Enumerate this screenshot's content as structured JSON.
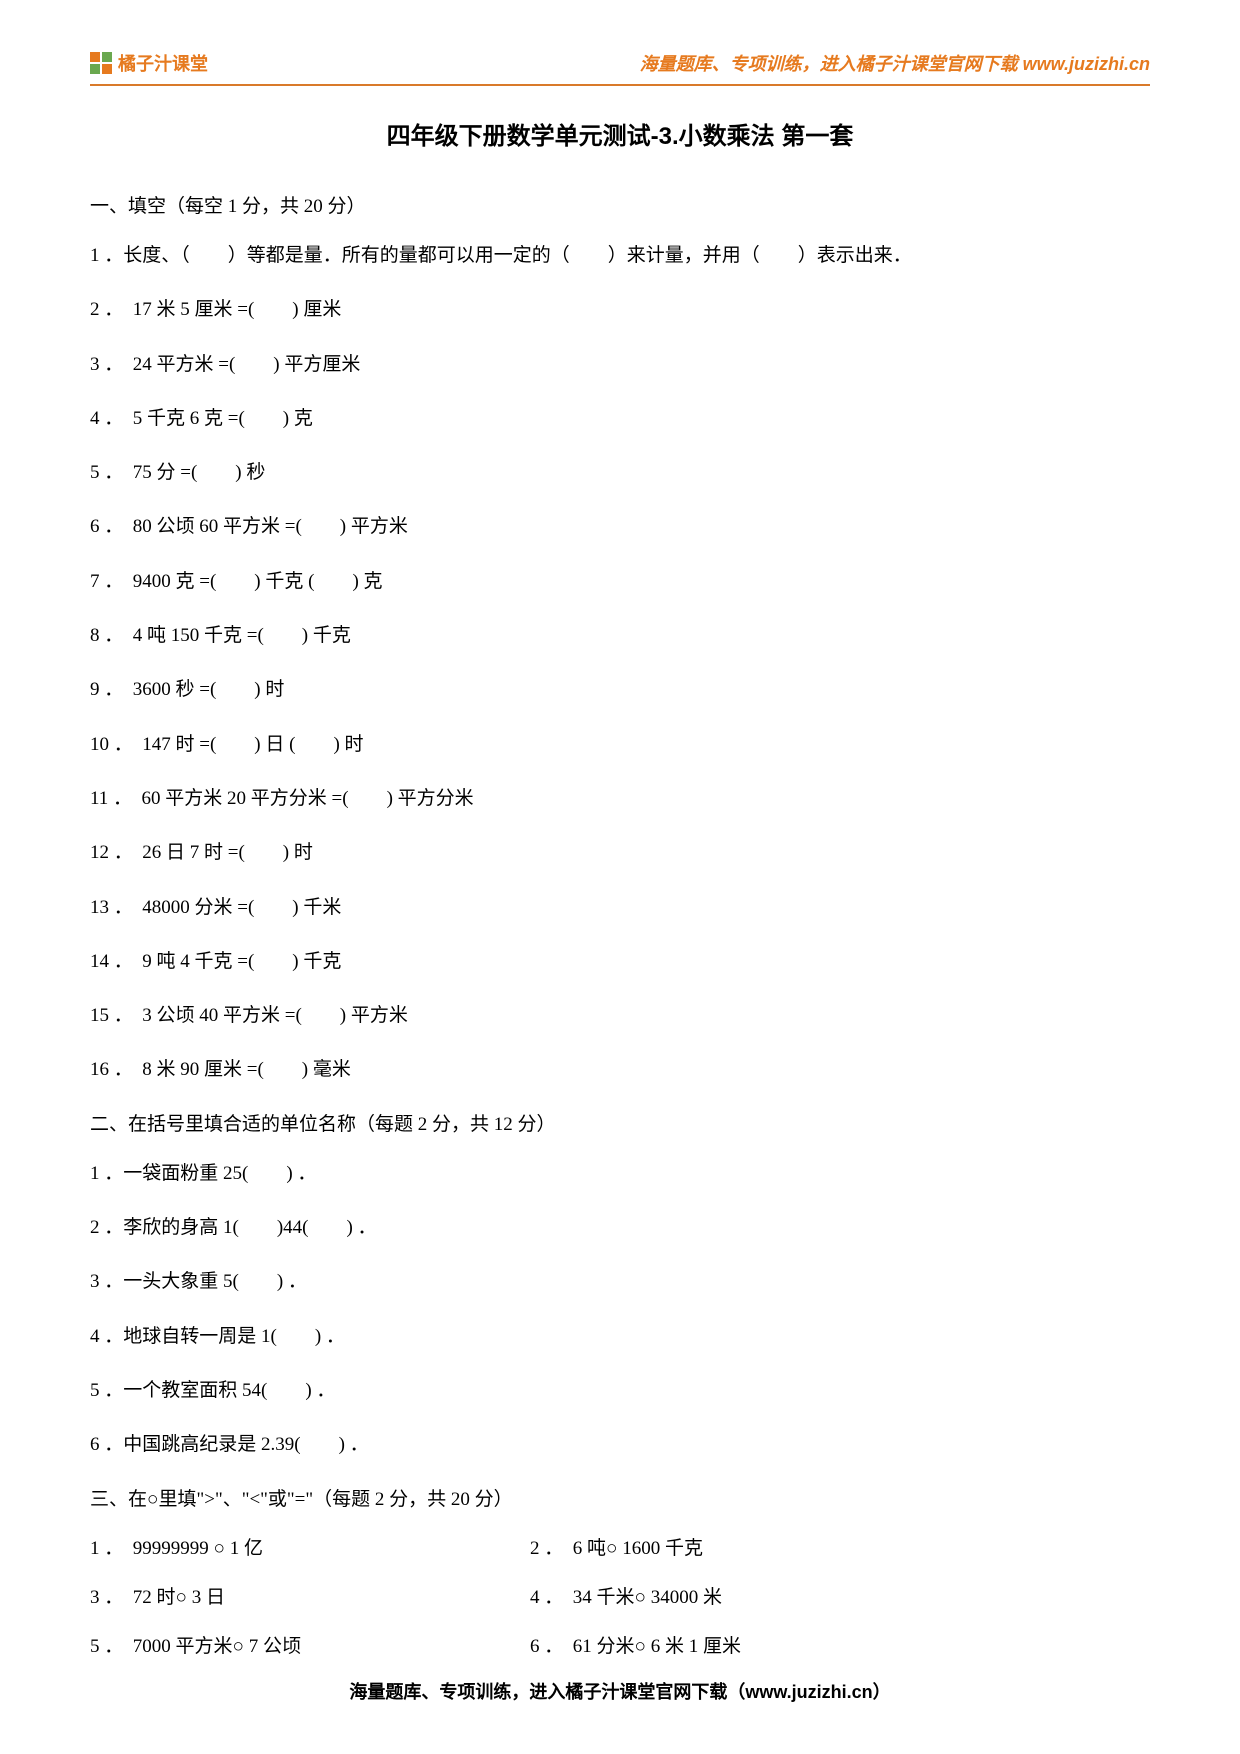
{
  "header": {
    "logo_text": "橘子汁课堂",
    "right_text": "海量题库、专项训练，进入橘子汁课堂官网下载 www.juzizhi.cn"
  },
  "title": "四年级下册数学单元测试-3.小数乘法 第一套",
  "section1": {
    "heading": "一、填空（每空 1 分，共 20 分）",
    "q1": "1 ．长度、（　　）等都是量．所有的量都可以用一定的（　　）来计量，并用（　　）表示出来．",
    "q2": "2 ．　17 米 5 厘米 =(　　) 厘米",
    "q3": "3 ．　24 平方米 =(　　) 平方厘米",
    "q4": "4 ．　5 千克 6 克 =(　　) 克",
    "q5": "5 ．　75 分 =(　　) 秒",
    "q6": "6 ．　80 公顷 60 平方米 =(　　) 平方米",
    "q7": "7 ．　9400 克 =(　　) 千克 (　　) 克",
    "q8": "8 ．　4 吨 150 千克 =(　　) 千克",
    "q9": "9 ．　3600 秒 =(　　) 时",
    "q10": "10 ．　147 时 =(　　) 日 (　　) 时",
    "q11": "11 ．　60 平方米 20 平方分米 =(　　) 平方分米",
    "q12": "12 ．　26 日 7 时 =(　　) 时",
    "q13": "13 ．　48000 分米 =(　　) 千米",
    "q14": "14 ．　9 吨 4 千克 =(　　) 千克",
    "q15": "15 ．　3 公顷 40 平方米 =(　　) 平方米",
    "q16": "16 ．　8 米 90 厘米 =(　　) 毫米"
  },
  "section2": {
    "heading": "二、在括号里填合适的单位名称（每题 2 分，共 12 分）",
    "q1": "1 ．一袋面粉重 25(　　) ．",
    "q2": "2 ．李欣的身高 1(　　)44(　　) ．",
    "q3": "3 ．一头大象重 5(　　) ．",
    "q4": "4 ．地球自转一周是 1(　　) ．",
    "q5": "5 ．一个教室面积 54(　　) ．",
    "q6": "6 ．中国跳高纪录是 2.39(　　) ．"
  },
  "section3": {
    "heading": "三、在○里填\">\"、\"<\"或\"=\"（每题 2 分，共 20 分）",
    "row1": {
      "left": "1 ．　99999999 ○ 1 亿",
      "right": "2 ．　6 吨○ 1600 千克"
    },
    "row2": {
      "left": "3 ．　72 时○ 3 日",
      "right": "4 ．　34 千米○ 34000 米"
    },
    "row3": {
      "left": "5 ．　7000 平方米○ 7 公顷",
      "right": "6 ．　61 分米○ 6 米 1 厘米"
    }
  },
  "footer": "海量题库、专项训练，进入橘子汁课堂官网下载（www.juzizhi.cn）"
}
